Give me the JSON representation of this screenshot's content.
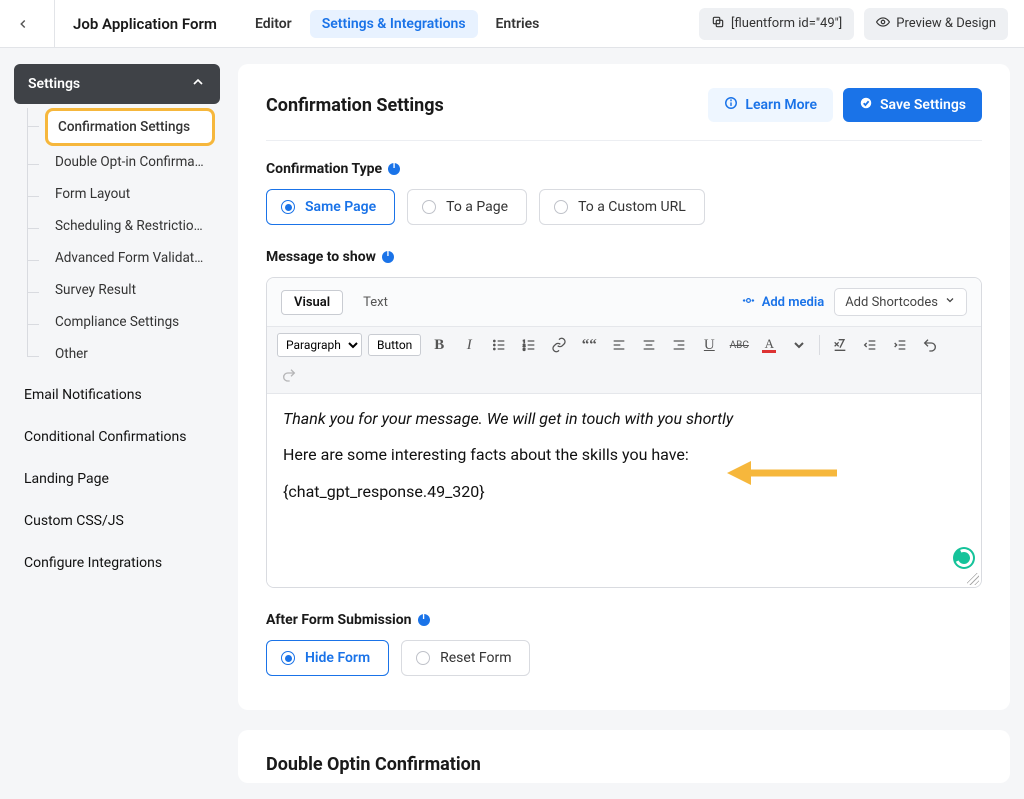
{
  "header": {
    "form_title": "Job Application Form",
    "tabs": {
      "editor": "Editor",
      "settings": "Settings & Integrations",
      "entries": "Entries"
    },
    "shortcode": "[fluentform id=\"49\"]",
    "preview": "Preview & Design"
  },
  "sidebar": {
    "group_label": "Settings",
    "items": [
      "Confirmation Settings",
      "Double Opt-in Confirma...",
      "Form Layout",
      "Scheduling & Restrictions",
      "Advanced Form Validati...",
      "Survey Result",
      "Compliance Settings",
      "Other"
    ],
    "links": [
      "Email Notifications",
      "Conditional Confirmations",
      "Landing Page",
      "Custom CSS/JS",
      "Configure Integrations"
    ]
  },
  "panel": {
    "title": "Confirmation Settings",
    "learn_more": "Learn More",
    "save": "Save Settings",
    "confirmation_type_label": "Confirmation Type",
    "types": {
      "same_page": "Same Page",
      "to_page": "To a Page",
      "to_url": "To a Custom URL"
    },
    "message_label": "Message to show",
    "editor": {
      "tab_visual": "Visual",
      "tab_text": "Text",
      "add_media": "Add media",
      "add_shortcodes": "Add Shortcodes",
      "para_select": "Paragraph",
      "kitchen_sink": "Button",
      "line1": "Thank you for your message. We will get in touch with you shortly",
      "line2": "Here are some interesting facts about the skills you have:",
      "line3": "{chat_gpt_response.49_320}"
    },
    "after_submit_label": "After Form Submission",
    "after_submit": {
      "hide": "Hide Form",
      "reset": "Reset Form"
    }
  },
  "next_section": {
    "title": "Double Optin Confirmation"
  }
}
